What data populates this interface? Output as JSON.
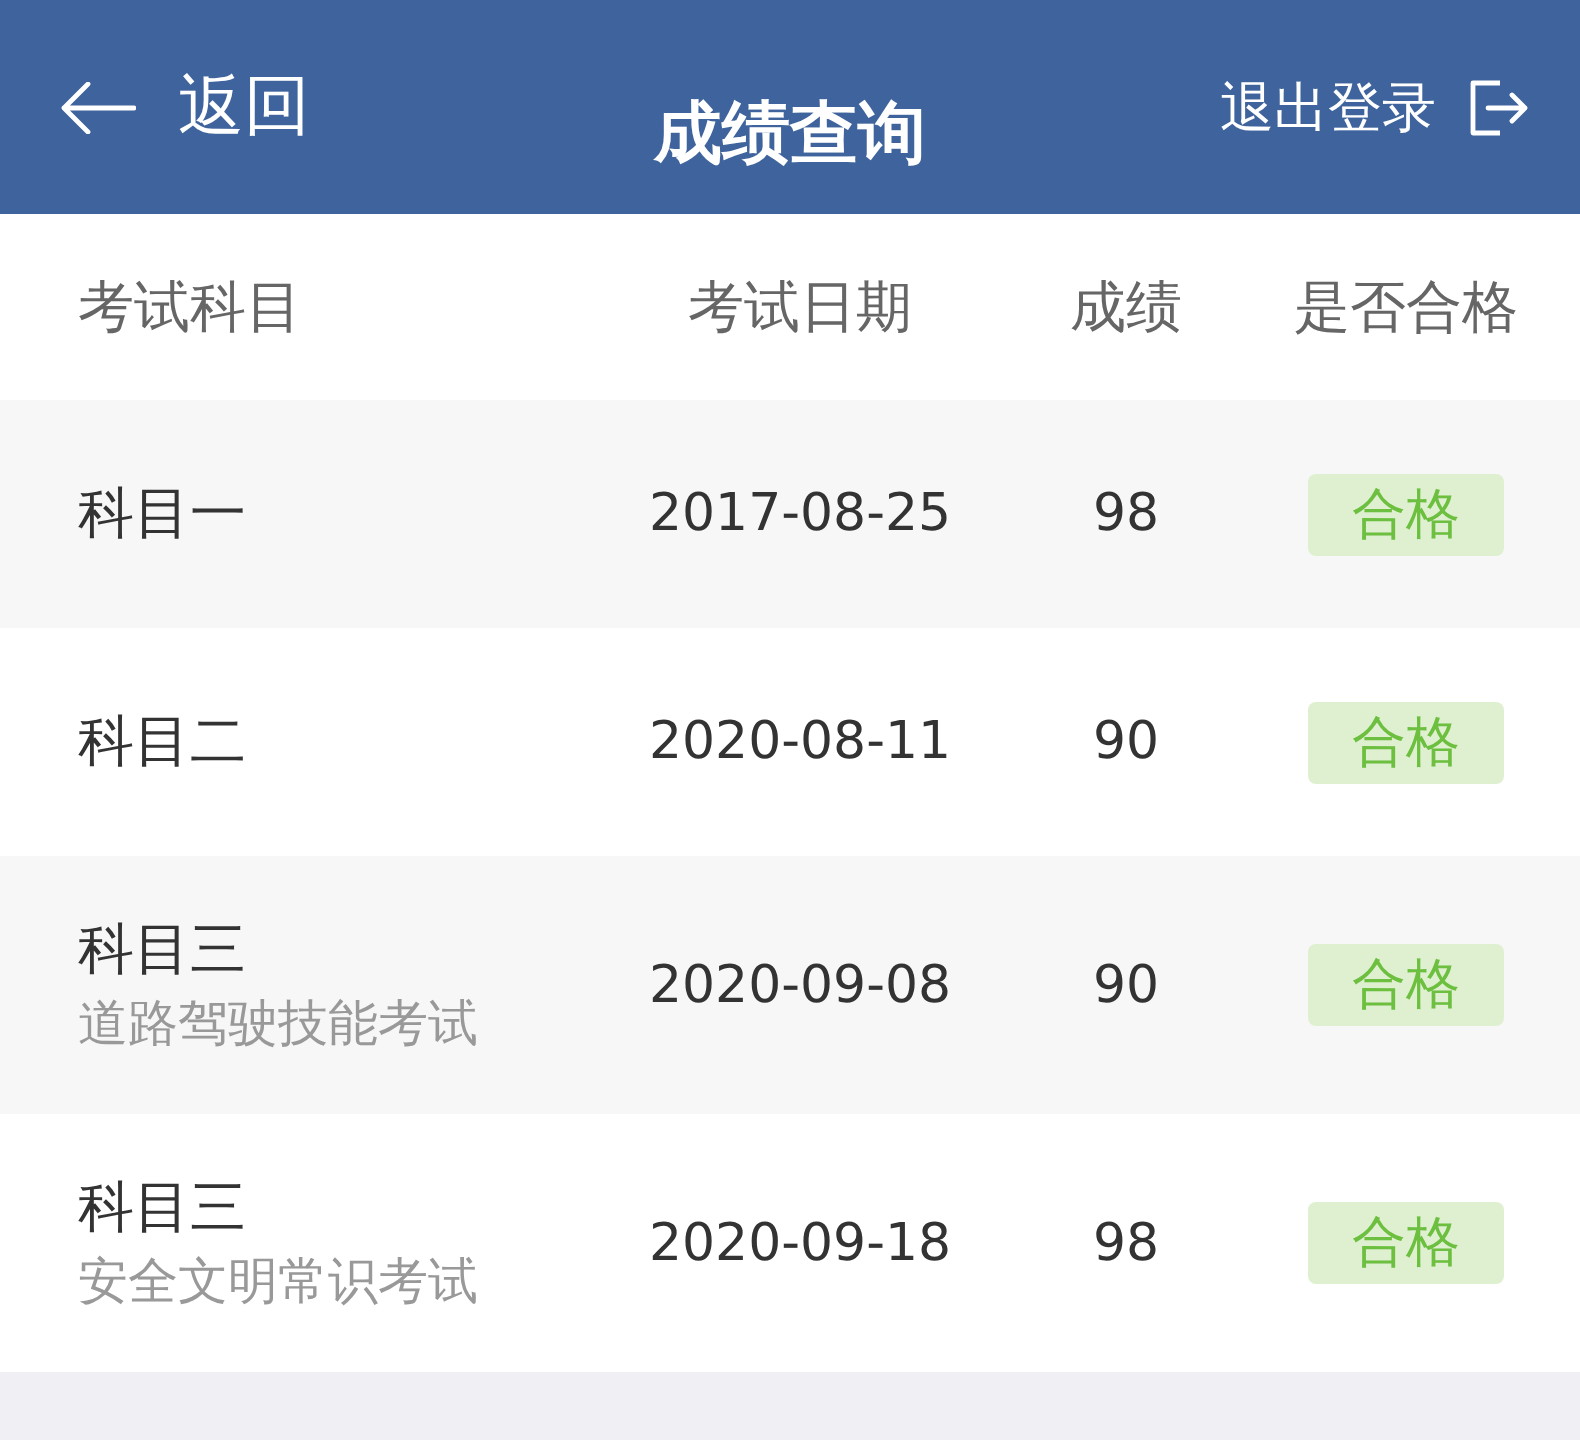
{
  "header": {
    "back_label": "返回",
    "title": "成绩查询",
    "logout_label": "退出登录"
  },
  "table": {
    "columns": [
      "考试科目",
      "考试日期",
      "成绩",
      "是否合格"
    ],
    "rows": [
      {
        "subject": "科目一",
        "date": "2017-08-25",
        "score": "98",
        "result": "合格",
        "passed": true
      },
      {
        "subject": "科目二",
        "date": "2020-08-11",
        "score": "90",
        "result": "合格",
        "passed": true
      },
      {
        "subject": "科目三",
        "detail": "道路驾驶技能考试",
        "date": "2020-09-08",
        "score": "90",
        "result": "合格",
        "passed": true
      },
      {
        "subject": "科目三",
        "detail": "安全文明常识考试",
        "date": "2020-09-18",
        "score": "98",
        "result": "合格",
        "passed": true
      }
    ]
  }
}
